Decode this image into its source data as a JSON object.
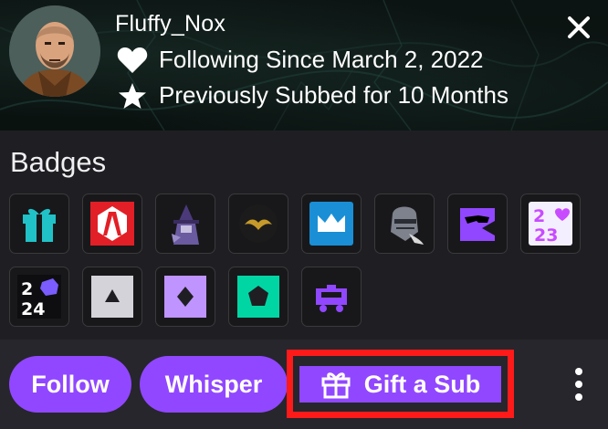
{
  "user": {
    "name": "Fluffy_Nox",
    "following_text": "Following Since March 2, 2022",
    "subbed_text": "Previously Subbed for 10 Months"
  },
  "badges_section": {
    "title": "Badges",
    "items": [
      {
        "icon": "gift-badge-icon",
        "color": "#20c2c7"
      },
      {
        "icon": "borderlands-vault-badge-icon",
        "color": "#e21f26"
      },
      {
        "icon": "witch-badge-icon",
        "color": "#5b4a8b"
      },
      {
        "icon": "gold-bat-badge-icon",
        "color": "#c59a2a"
      },
      {
        "icon": "crown-badge-icon",
        "color": "#1a8fd6"
      },
      {
        "icon": "knight-helmet-badge-icon",
        "color": "#8a8f99"
      },
      {
        "icon": "sunglasses-glitch-badge-icon",
        "color": "#9147ff"
      },
      {
        "icon": "year-2023-badge-icon",
        "color": "#c84bff"
      },
      {
        "icon": "year-2024-badge-icon",
        "color": "#7a5cff"
      },
      {
        "icon": "grey-triangle-badge-icon",
        "color": "#d3d3d9"
      },
      {
        "icon": "purple-diamond-badge-icon",
        "color": "#bf94ff"
      },
      {
        "icon": "teal-pentagon-badge-icon",
        "color": "#00d6a4"
      },
      {
        "icon": "purple-cart-badge-icon",
        "color": "#9147ff"
      }
    ]
  },
  "actions": {
    "follow_label": "Follow",
    "whisper_label": "Whisper",
    "gift_label": "Gift a Sub"
  },
  "colors": {
    "accent": "#9147ff",
    "highlight_outline": "#ff1a1a",
    "background": "#1f1f23"
  }
}
